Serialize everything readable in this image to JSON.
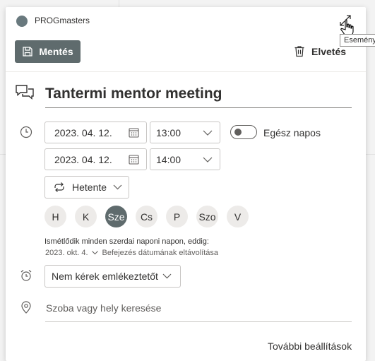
{
  "calendar": {
    "name": "PROGmasters",
    "color": "#69797e"
  },
  "tooltip": "Esemény",
  "toolbar": {
    "save_label": "Mentés",
    "discard_label": "Elvetés"
  },
  "event": {
    "title": "Tantermi mentor meeting"
  },
  "start": {
    "date": "2023. 04. 12.",
    "time": "13:00"
  },
  "end": {
    "date": "2023. 04. 12.",
    "time": "14:00"
  },
  "all_day": {
    "label": "Egész napos",
    "on": false
  },
  "repeat": {
    "label": "Hetente"
  },
  "days": [
    {
      "label": "H",
      "active": false
    },
    {
      "label": "K",
      "active": false
    },
    {
      "label": "Sze",
      "active": true
    },
    {
      "label": "Cs",
      "active": false
    },
    {
      "label": "P",
      "active": false
    },
    {
      "label": "Szo",
      "active": false
    },
    {
      "label": "V",
      "active": false
    }
  ],
  "recurrence": {
    "summary": "Ismétlődik minden szerdai naponi napon, eddig:",
    "end_date": "2023. okt. 4.",
    "remove_end_label": "Befejezés dátumának eltávolítása"
  },
  "reminder": {
    "label": "Nem kérek emlékeztetőt"
  },
  "location": {
    "placeholder": "Szoba vagy hely keresése"
  },
  "more_settings": "További beállítások",
  "colors": {
    "accent": "#5f6b6d",
    "surface": "#ffffff",
    "border": "#c8c6c4"
  }
}
